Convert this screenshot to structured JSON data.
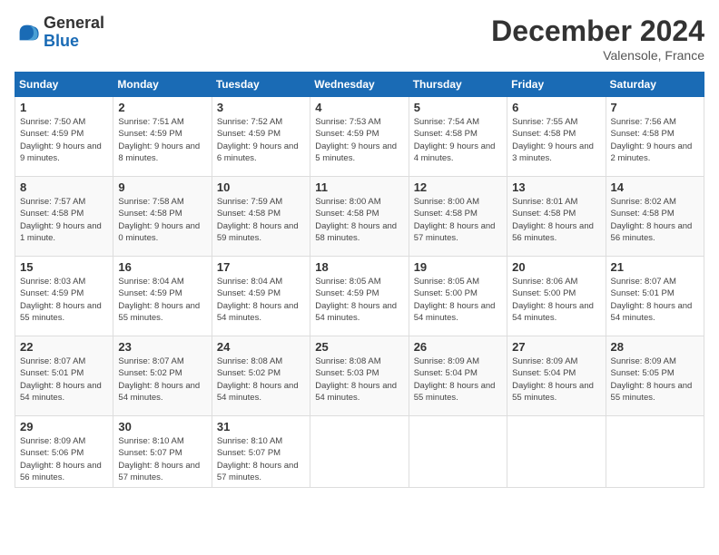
{
  "header": {
    "logo": {
      "general": "General",
      "blue": "Blue"
    },
    "title": "December 2024",
    "location": "Valensole, France"
  },
  "calendar": {
    "days_of_week": [
      "Sunday",
      "Monday",
      "Tuesday",
      "Wednesday",
      "Thursday",
      "Friday",
      "Saturday"
    ],
    "weeks": [
      [
        {
          "day": "1",
          "sunrise": "7:50 AM",
          "sunset": "4:59 PM",
          "daylight": "9 hours and 9 minutes."
        },
        {
          "day": "2",
          "sunrise": "7:51 AM",
          "sunset": "4:59 PM",
          "daylight": "9 hours and 8 minutes."
        },
        {
          "day": "3",
          "sunrise": "7:52 AM",
          "sunset": "4:59 PM",
          "daylight": "9 hours and 6 minutes."
        },
        {
          "day": "4",
          "sunrise": "7:53 AM",
          "sunset": "4:59 PM",
          "daylight": "9 hours and 5 minutes."
        },
        {
          "day": "5",
          "sunrise": "7:54 AM",
          "sunset": "4:58 PM",
          "daylight": "9 hours and 4 minutes."
        },
        {
          "day": "6",
          "sunrise": "7:55 AM",
          "sunset": "4:58 PM",
          "daylight": "9 hours and 3 minutes."
        },
        {
          "day": "7",
          "sunrise": "7:56 AM",
          "sunset": "4:58 PM",
          "daylight": "9 hours and 2 minutes."
        }
      ],
      [
        {
          "day": "8",
          "sunrise": "7:57 AM",
          "sunset": "4:58 PM",
          "daylight": "9 hours and 1 minute."
        },
        {
          "day": "9",
          "sunrise": "7:58 AM",
          "sunset": "4:58 PM",
          "daylight": "9 hours and 0 minutes."
        },
        {
          "day": "10",
          "sunrise": "7:59 AM",
          "sunset": "4:58 PM",
          "daylight": "8 hours and 59 minutes."
        },
        {
          "day": "11",
          "sunrise": "8:00 AM",
          "sunset": "4:58 PM",
          "daylight": "8 hours and 58 minutes."
        },
        {
          "day": "12",
          "sunrise": "8:00 AM",
          "sunset": "4:58 PM",
          "daylight": "8 hours and 57 minutes."
        },
        {
          "day": "13",
          "sunrise": "8:01 AM",
          "sunset": "4:58 PM",
          "daylight": "8 hours and 56 minutes."
        },
        {
          "day": "14",
          "sunrise": "8:02 AM",
          "sunset": "4:58 PM",
          "daylight": "8 hours and 56 minutes."
        }
      ],
      [
        {
          "day": "15",
          "sunrise": "8:03 AM",
          "sunset": "4:59 PM",
          "daylight": "8 hours and 55 minutes."
        },
        {
          "day": "16",
          "sunrise": "8:04 AM",
          "sunset": "4:59 PM",
          "daylight": "8 hours and 55 minutes."
        },
        {
          "day": "17",
          "sunrise": "8:04 AM",
          "sunset": "4:59 PM",
          "daylight": "8 hours and 54 minutes."
        },
        {
          "day": "18",
          "sunrise": "8:05 AM",
          "sunset": "4:59 PM",
          "daylight": "8 hours and 54 minutes."
        },
        {
          "day": "19",
          "sunrise": "8:05 AM",
          "sunset": "5:00 PM",
          "daylight": "8 hours and 54 minutes."
        },
        {
          "day": "20",
          "sunrise": "8:06 AM",
          "sunset": "5:00 PM",
          "daylight": "8 hours and 54 minutes."
        },
        {
          "day": "21",
          "sunrise": "8:07 AM",
          "sunset": "5:01 PM",
          "daylight": "8 hours and 54 minutes."
        }
      ],
      [
        {
          "day": "22",
          "sunrise": "8:07 AM",
          "sunset": "5:01 PM",
          "daylight": "8 hours and 54 minutes."
        },
        {
          "day": "23",
          "sunrise": "8:07 AM",
          "sunset": "5:02 PM",
          "daylight": "8 hours and 54 minutes."
        },
        {
          "day": "24",
          "sunrise": "8:08 AM",
          "sunset": "5:02 PM",
          "daylight": "8 hours and 54 minutes."
        },
        {
          "day": "25",
          "sunrise": "8:08 AM",
          "sunset": "5:03 PM",
          "daylight": "8 hours and 54 minutes."
        },
        {
          "day": "26",
          "sunrise": "8:09 AM",
          "sunset": "5:04 PM",
          "daylight": "8 hours and 55 minutes."
        },
        {
          "day": "27",
          "sunrise": "8:09 AM",
          "sunset": "5:04 PM",
          "daylight": "8 hours and 55 minutes."
        },
        {
          "day": "28",
          "sunrise": "8:09 AM",
          "sunset": "5:05 PM",
          "daylight": "8 hours and 55 minutes."
        }
      ],
      [
        {
          "day": "29",
          "sunrise": "8:09 AM",
          "sunset": "5:06 PM",
          "daylight": "8 hours and 56 minutes."
        },
        {
          "day": "30",
          "sunrise": "8:10 AM",
          "sunset": "5:07 PM",
          "daylight": "8 hours and 57 minutes."
        },
        {
          "day": "31",
          "sunrise": "8:10 AM",
          "sunset": "5:07 PM",
          "daylight": "8 hours and 57 minutes."
        },
        null,
        null,
        null,
        null
      ]
    ]
  }
}
